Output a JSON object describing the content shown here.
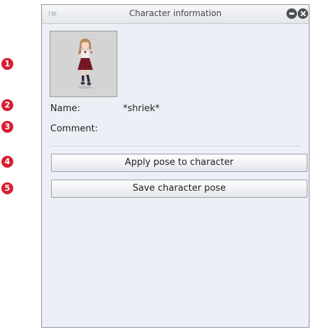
{
  "callouts": [
    "1",
    "2",
    "3",
    "4",
    "5"
  ],
  "panel": {
    "title": "Character information",
    "grip_glyph": "⁞≡",
    "title_buttons": [
      "minimize-icon",
      "close-icon"
    ]
  },
  "character": {
    "thumbnail_icon": "character-figure-icon",
    "name_label": "Name:",
    "name_value": "*shriek*",
    "comment_label": "Comment:",
    "comment_value": ""
  },
  "actions": {
    "apply_label": "Apply pose to character",
    "save_label": "Save character pose"
  },
  "colors": {
    "callout": "#d81e32",
    "panel_bg": "#eceff6"
  }
}
